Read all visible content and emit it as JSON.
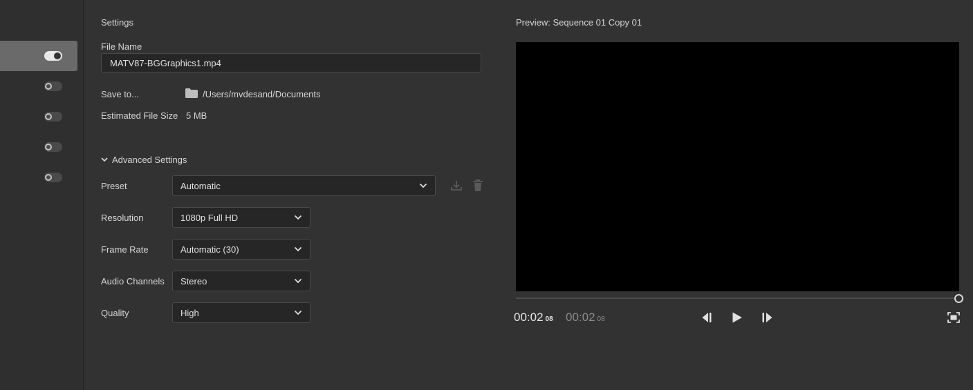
{
  "rail": {
    "toggles": [
      {
        "on": true
      },
      {
        "on": false
      },
      {
        "on": false
      },
      {
        "on": false
      },
      {
        "on": false
      }
    ]
  },
  "settings": {
    "title": "Settings",
    "file_name_label": "File Name",
    "file_name_value": "MATV87-BGGraphics1.mp4",
    "save_to_label": "Save to...",
    "save_to_path": "/Users/mvdesand/Documents",
    "estimated_size_label": "Estimated File Size",
    "estimated_size_value": "5 MB",
    "advanced_label": "Advanced Settings",
    "preset_label": "Preset",
    "preset_value": "Automatic",
    "resolution_label": "Resolution",
    "resolution_value": "1080p Full HD",
    "frame_rate_label": "Frame Rate",
    "frame_rate_value": "Automatic (30)",
    "audio_channels_label": "Audio Channels",
    "audio_channels_value": "Stereo",
    "quality_label": "Quality",
    "quality_value": "High"
  },
  "preview": {
    "title": "Preview: Sequence 01 Copy 01",
    "current_time": "00:02",
    "current_frames": "08",
    "duration_time": "00:02",
    "duration_frames": "08",
    "playhead_fraction": 1.0
  },
  "icons": {
    "folder": "folder-icon",
    "chevron": "chevron-down-icon",
    "save_preset": "save-preset-icon",
    "delete_preset": "trash-icon",
    "step_back": "step-back-icon",
    "play": "play-icon",
    "step_forward": "step-forward-icon",
    "fit": "fit-frame-icon"
  },
  "colors": {
    "background": "#323232",
    "rail_background": "#2f2f2f",
    "active_rail_item": "#6a6a6a",
    "input_background": "#262626",
    "text": "#d6d6d6"
  }
}
